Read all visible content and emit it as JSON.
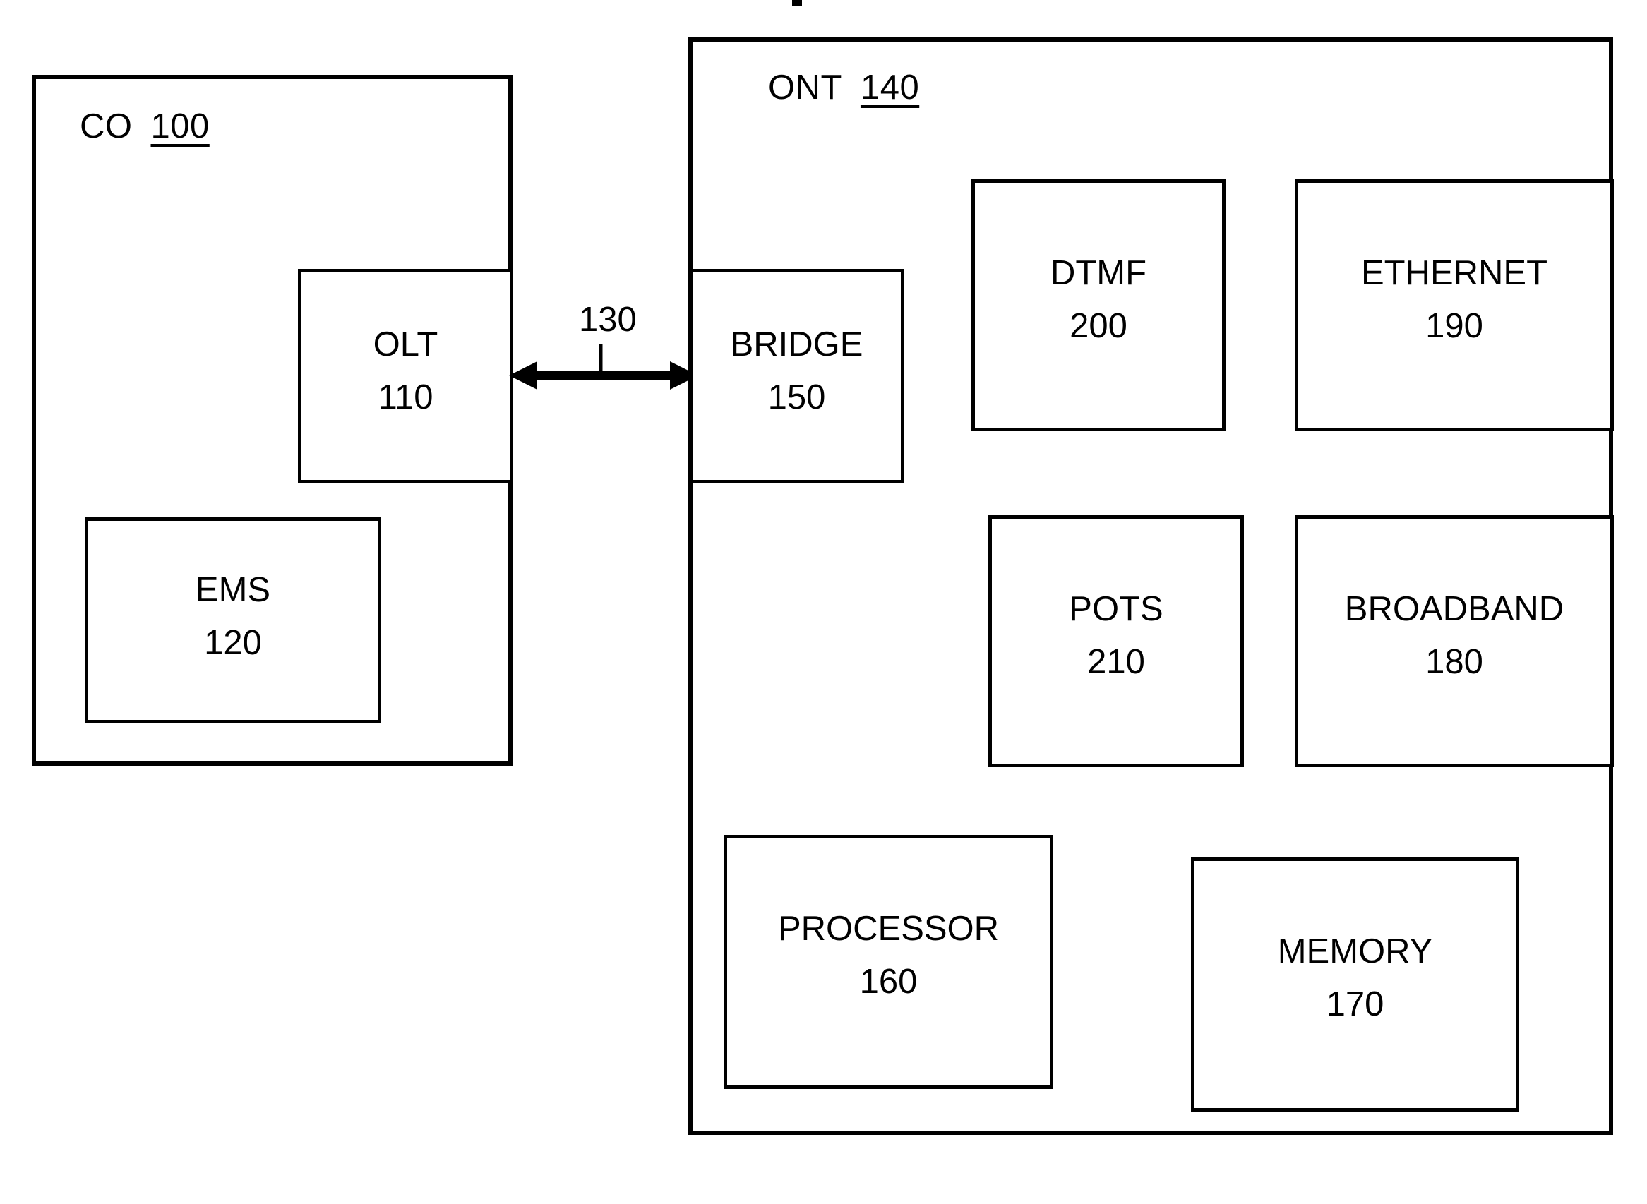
{
  "diagram": {
    "containers": [
      {
        "id": "co",
        "label": "CO",
        "ref": "100"
      },
      {
        "id": "ont",
        "label": "ONT",
        "ref": "140"
      }
    ],
    "blocks": [
      {
        "id": "olt",
        "name": "OLT",
        "num": "110"
      },
      {
        "id": "ems",
        "name": "EMS",
        "num": "120"
      },
      {
        "id": "bridge",
        "name": "BRIDGE",
        "num": "150"
      },
      {
        "id": "dtmf",
        "name": "DTMF",
        "num": "200"
      },
      {
        "id": "ethernet",
        "name": "ETHERNET",
        "num": "190"
      },
      {
        "id": "pots",
        "name": "POTS",
        "num": "210"
      },
      {
        "id": "broadband",
        "name": "BROADBAND",
        "num": "180"
      },
      {
        "id": "processor",
        "name": "PROCESSOR",
        "num": "160"
      },
      {
        "id": "memory",
        "name": "MEMORY",
        "num": "170"
      }
    ],
    "connections": [
      {
        "id": "olt-bridge",
        "ref": "130",
        "from": "olt",
        "to": "bridge",
        "style": "double-arrow"
      }
    ],
    "colors": {
      "stroke": "#000000",
      "background": "#ffffff",
      "text": "#000000"
    }
  }
}
